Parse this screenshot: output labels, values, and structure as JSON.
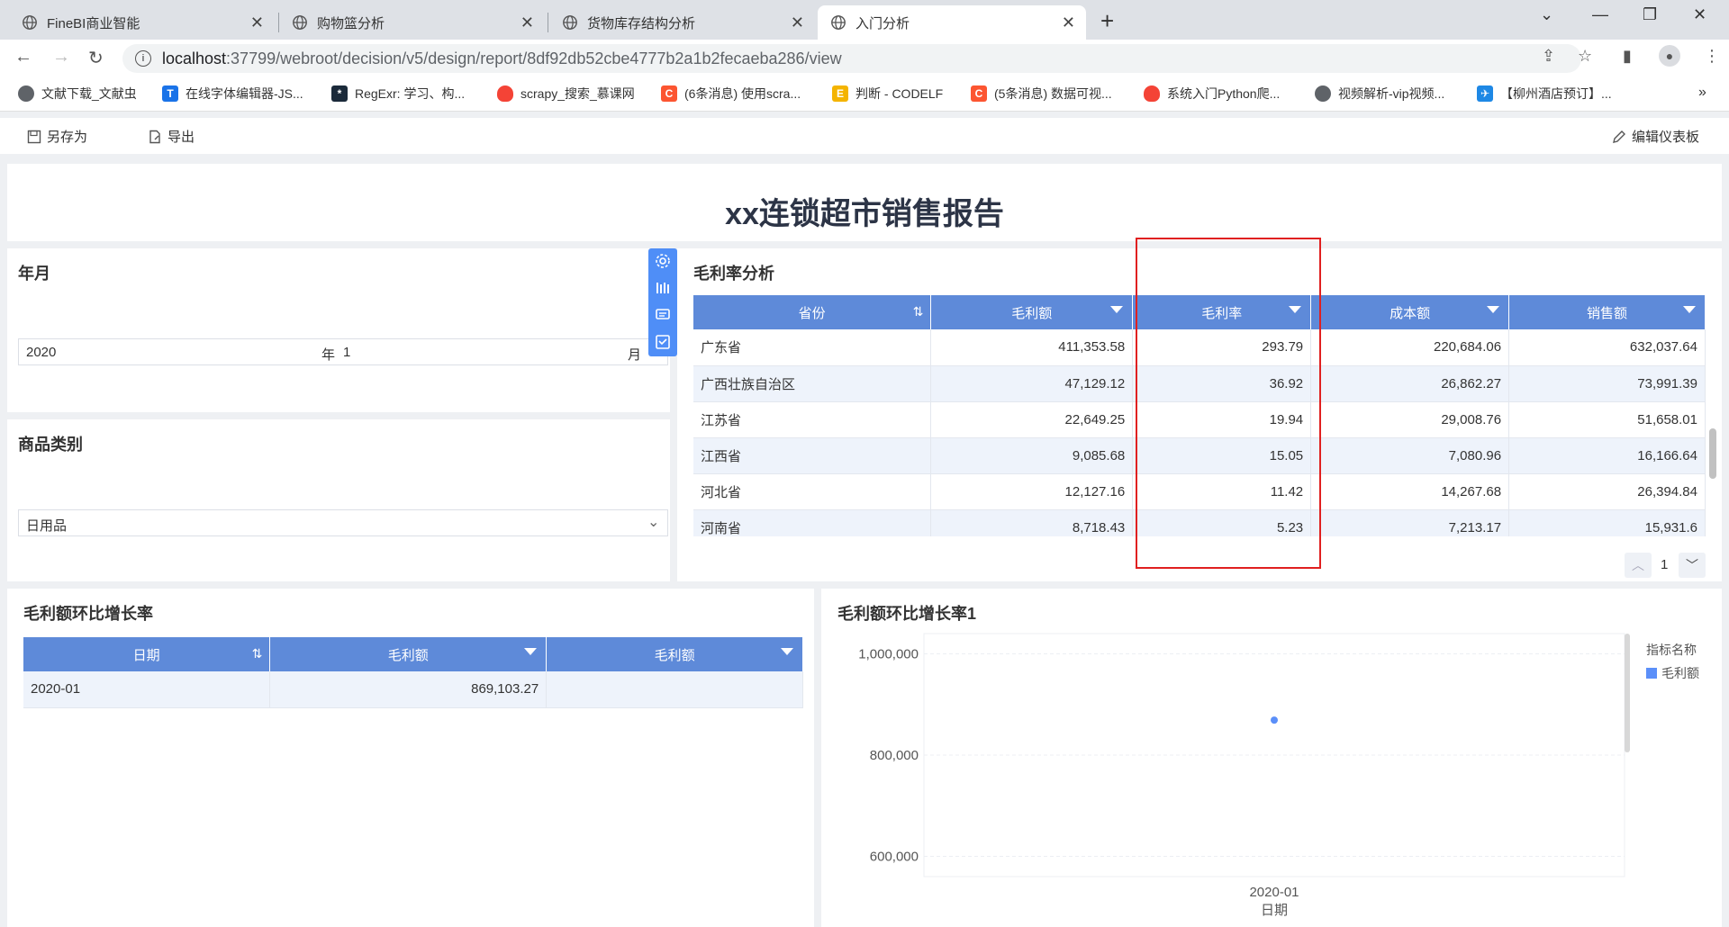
{
  "browser": {
    "tabs": [
      {
        "title": "FineBI商业智能"
      },
      {
        "title": "购物篮分析"
      },
      {
        "title": "货物库存结构分析"
      },
      {
        "title": "入门分析"
      }
    ],
    "url_host": "localhost",
    "url_path": ":37799/webroot/decision/v5/design/report/8df92db52cbe4777b2a1b2fecaeba286/view",
    "bookmarks": [
      {
        "label": "文献下载_文献虫"
      },
      {
        "label": "在线字体编辑器-JS..."
      },
      {
        "label": "RegExr: 学习、构..."
      },
      {
        "label": "scrapy_搜索_慕课网"
      },
      {
        "label": "(6条消息) 使用scra..."
      },
      {
        "label": "判断 - CODELF"
      },
      {
        "label": "(5条消息) 数据可视..."
      },
      {
        "label": "系统入门Python爬..."
      },
      {
        "label": "视频解析-vip视频..."
      },
      {
        "label": "【柳州酒店预订】..."
      }
    ],
    "more": "»"
  },
  "toolbar": {
    "save_as": "另存为",
    "export": "导出",
    "edit_dashboard": "编辑仪表板"
  },
  "report": {
    "title": "xx连锁超市销售报告"
  },
  "filter_yearmonth": {
    "title": "年月",
    "year": "2020",
    "year_unit": "年",
    "month": "1",
    "month_unit": "月"
  },
  "filter_category": {
    "title": "商品类别",
    "value": "日用品"
  },
  "gross_margin_table": {
    "title": "毛利率分析",
    "columns": [
      "省份",
      "毛利额",
      "毛利率",
      "成本额",
      "销售额"
    ],
    "rows": [
      [
        "广东省",
        "411,353.58",
        "293.79",
        "220,684.06",
        "632,037.64"
      ],
      [
        "广西壮族自治区",
        "47,129.12",
        "36.92",
        "26,862.27",
        "73,991.39"
      ],
      [
        "江苏省",
        "22,649.25",
        "19.94",
        "29,008.76",
        "51,658.01"
      ],
      [
        "江西省",
        "9,085.68",
        "15.05",
        "7,080.96",
        "16,166.64"
      ],
      [
        "河北省",
        "12,127.16",
        "11.42",
        "14,267.68",
        "26,394.84"
      ],
      [
        "河南省",
        "8,718.43",
        "5.23",
        "7,213.17",
        "15,931.6"
      ]
    ],
    "page": "1"
  },
  "mom_table": {
    "title": "毛利额环比增长率",
    "columns": [
      "日期",
      "毛利额",
      "毛利额"
    ],
    "rows": [
      [
        "2020-01",
        "869,103.27",
        ""
      ]
    ]
  },
  "mom_chart": {
    "title": "毛利额环比增长率1",
    "legend_title": "指标名称",
    "colors": {
      "series": "#5b8ff9"
    }
  },
  "chart_data": {
    "type": "scatter",
    "x": [
      "2020-01"
    ],
    "series": [
      {
        "name": "毛利额",
        "values": [
          869103.27
        ]
      }
    ],
    "xlabel": "日期",
    "ylabel": "",
    "y_ticks": [
      "1,000,000",
      "800,000",
      "600,000"
    ],
    "y_tick_values": [
      1000000,
      800000,
      600000
    ],
    "ylim": [
      560000,
      1040000
    ],
    "grid": true,
    "legend_position": "right"
  }
}
